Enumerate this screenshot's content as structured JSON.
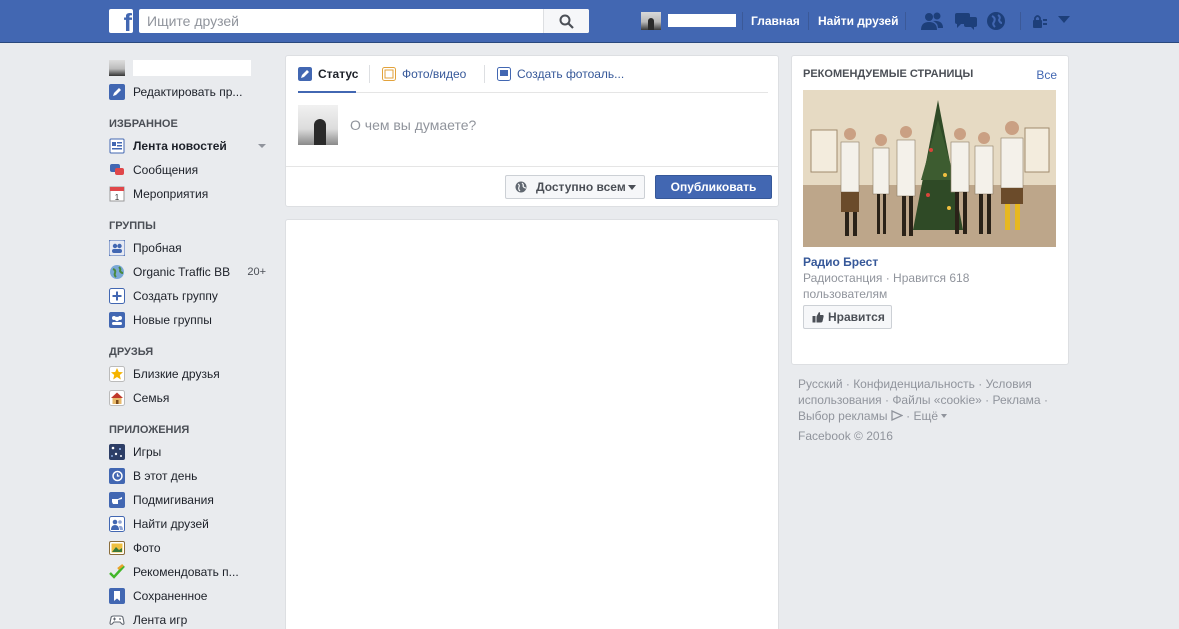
{
  "topbar": {
    "search_placeholder": "Ищите друзей",
    "nav": [
      "Главная",
      "Найти друзей"
    ]
  },
  "sidebar": {
    "profile_edit": "Редактировать пр...",
    "sections": {
      "favorites": "ИЗБРАННОЕ",
      "groups": "ГРУППЫ",
      "friends": "ДРУЗЬЯ",
      "apps": "ПРИЛОЖЕНИЯ"
    },
    "favorites": [
      "Лента новостей",
      "Сообщения",
      "Мероприятия"
    ],
    "events_icon_day": "1",
    "groups": [
      "Пробная",
      "Organic Traffic BB",
      "Создать группу",
      "Новые группы"
    ],
    "organic_count": "20+",
    "friends": [
      "Близкие друзья",
      "Семья"
    ],
    "apps": [
      "Игры",
      "В этот день",
      "Подмигивания",
      "Найти друзей",
      "Фото",
      "Рекомендовать п...",
      "Сохраненное",
      "Лента игр"
    ]
  },
  "composer": {
    "tabs": [
      "Статус",
      "Фото/видео",
      "Создать фотоаль..."
    ],
    "placeholder": "О чем вы думаете?",
    "audience": "Доступно всем",
    "publish": "Опубликовать"
  },
  "recommended": {
    "title": "РЕКОМЕНДУЕМЫЕ СТРАНИЦЫ",
    "see_all": "Все",
    "page_name": "Радио Брест",
    "meta": "Радиостанция · Нравится 618 пользователям",
    "like": "Нравится"
  },
  "footer": {
    "links": "Русский · Конфиденциальность · Условия использования · Файлы «cookie» · Реклама · Выбор рекламы",
    "more": "Ещё",
    "copyright": "Facebook © 2016"
  },
  "colors": {
    "brand": "#4267b2",
    "link": "#365899",
    "background": "#e9ebee"
  }
}
